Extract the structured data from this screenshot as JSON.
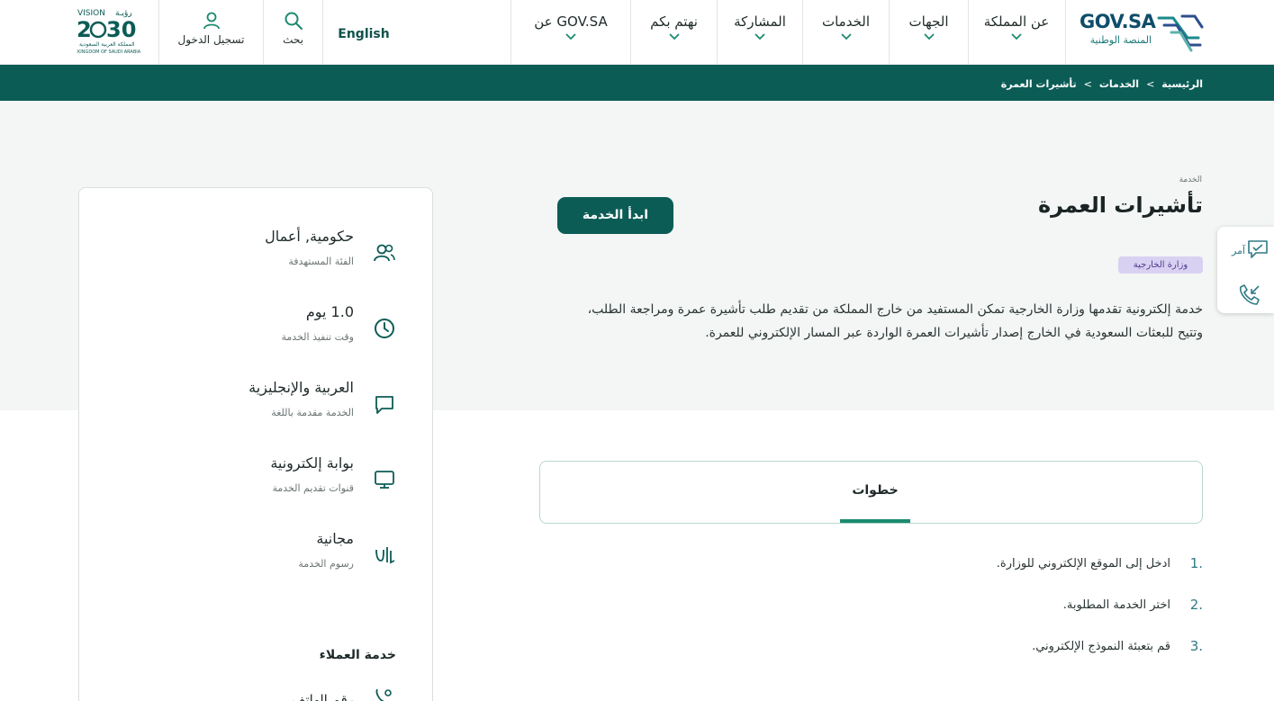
{
  "header": {
    "brand": "GOV.SA",
    "brand_sub": "المنصة الوطنية",
    "nav": [
      {
        "label": "عن المملكة"
      },
      {
        "label": "الجهات"
      },
      {
        "label": "الخدمات"
      },
      {
        "label": "المشاركة"
      },
      {
        "label": "نهتم بكم"
      },
      {
        "label": "عن GOV.SA"
      }
    ],
    "language_toggle": "English",
    "search_label": "بحث",
    "login_label": "تسجيل الدخول",
    "vision_logo_text": "VISION 2030 رؤية المملكة العربية السعودية KINGDOM OF SAUDI ARABIA"
  },
  "breadcrumb": [
    "الرئيسية",
    "الخدمات",
    "تأشيرات العمرة"
  ],
  "breadcrumb_separator": ">",
  "service": {
    "kicker": "الخدمة",
    "title": "تأشيرات العمرة",
    "start_button": "ابدأ الخدمة",
    "agency": "وزارة الخارجية",
    "description": "خدمة إلكترونية تقدمها وزارة الخارجية تمكن المستفيد من خارج المملكة من تقديم طلب تأشيرة عمرة ومراجعة الطلب، وتتيح للبعثات السعودية في الخارج إصدار تأشيرات العمرة الواردة عبر المسار الإلكتروني للعمرة."
  },
  "info": [
    {
      "icon": "users-icon",
      "value": "حكومية, أعمال",
      "caption": "الفئة المستهدفة"
    },
    {
      "icon": "clock-icon",
      "value": "1.0 يوم",
      "caption": "وقت تنفيذ الخدمة"
    },
    {
      "icon": "chat-bubble-icon",
      "value": "العربية والإنجليزية",
      "caption": "الخدمة مقدمة باللغة"
    },
    {
      "icon": "monitor-icon",
      "value": "بوابة إلكترونية",
      "caption": "قنوات تقديم الخدمة"
    },
    {
      "icon": "riyal-icon",
      "value": "مجانية",
      "caption": "رسوم الخدمة"
    }
  ],
  "customer_service": {
    "title": "خدمة العملاء",
    "partial_item": "رقم الهاتف"
  },
  "floating_widget": {
    "amer_label": "آمر"
  },
  "tabs": {
    "steps_label": "خطوات"
  },
  "steps": [
    {
      "num": "1.",
      "text": "ادخل إلى الموقع الإلكتروني للوزارة."
    },
    {
      "num": "2.",
      "text": "اختر الخدمة المطلوبة."
    },
    {
      "num": "3.",
      "text": "قم بتعبئة النموذج الإلكتروني."
    }
  ],
  "colors": {
    "primary": "#0c5c56",
    "accent": "#1b8a6e",
    "brand_blue": "#0e4d6b",
    "badge_bg": "#d9d1f2",
    "badge_text": "#4f3b8f",
    "hero_bg": "#f3f6f5"
  }
}
